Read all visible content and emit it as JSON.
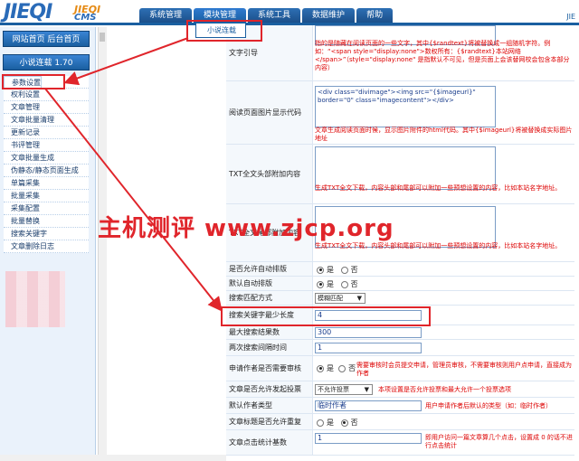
{
  "header": {
    "logo_main": "JIEQI",
    "logo_sub1": "JIEQI",
    "logo_sub2": "CMS",
    "tabs": [
      "系统管理",
      "模块管理",
      "系统工具",
      "数据维护",
      "帮助"
    ],
    "user_link": "JIE"
  },
  "dropdown": {
    "item": "小说连载"
  },
  "sidebar": {
    "home_button": "网站首页 后台首页",
    "module_title": "小说连载 1.70",
    "items": [
      "参数设置",
      "权限管理",
      "权利设置",
      "文章管理",
      "文章批量清理",
      "更新记录",
      "书评管理",
      "文章批量生成",
      "伪静态/静态页面生成",
      "单篇采集",
      "批量采集",
      "采集配置",
      "批量替换",
      "搜索关键字",
      "文章删除日志"
    ]
  },
  "form": {
    "row1": {
      "label": "文字引导",
      "note": "指的是随藏在阅读页面的一些文字，其中{$randtext}将被替换成一组随机字符。例如：“<span style=\"display:none\">数权所有：{$randtext}本站网络</span>”（style=\"display:none\" 是指默认不可见，但是页面上会该替网校会包含本部分内容）"
    },
    "row2": {
      "label": "阅读页面图片显示代码",
      "value": "<div class=\"divimage\"><img src=\"{$imageurl}\" border=\"0\" class=\"imagecontent\"></div>",
      "note": "文章生成阅读页面时候，显示图片附件的html代码。其中{$imageurl}将被替换成实际图片地址"
    },
    "row3": {
      "label": "TXT全文头部附加内容",
      "note": "生成TXT全文下载，内容头部和尾部可以附加一些预想设置的内容，比如本站名字地址。"
    },
    "row4": {
      "label": "TXT全文尾部附加内容",
      "note": "生成TXT全文下载，内容头部和尾部可以附加一些预想设置的内容，比如本站名字地址。"
    },
    "row5": {
      "label": "是否允许自动排版",
      "opt_yes": "是",
      "opt_no": "否"
    },
    "row6": {
      "label": "默认自动排版",
      "opt_yes": "是",
      "opt_no": "否"
    },
    "row7": {
      "label": "搜索匹配方式",
      "value": "模糊匹配"
    },
    "row8": {
      "label": "搜索关键字最少长度",
      "value": "4"
    },
    "row9": {
      "label": "最大搜索结果数",
      "value": "300"
    },
    "row10": {
      "label": "两次搜索间隔时间",
      "value": "1"
    },
    "row11": {
      "label": "申请作者是否需要审核",
      "opt_yes": "是",
      "opt_no": "否",
      "note": "需要审核时会员提交申请，管理员审核，不需要审核则用户点申请，直接成为作者"
    },
    "row12": {
      "label": "文章是否允许发起投票",
      "value": "不允许投票",
      "note": "本项设置是否允许投票和最大允许一个投票选项"
    },
    "row13": {
      "label": "默认作者类型",
      "value": "临时作者",
      "note": "用户申请作者后默认的类型（如：临时作者）"
    },
    "row14": {
      "label": "文章标题是否允许重复",
      "opt_yes": "是",
      "opt_no": "否"
    },
    "row15": {
      "label": "文章点击统计基数",
      "value": "1",
      "note": "即用户访问一篇文章算几个点击，设置成 0 的话不进行点击统计"
    }
  },
  "watermark": "主机测评 www.zjcp.org",
  "colors": {
    "accent": "#1a5fa0",
    "annotation": "#e0252b",
    "note": "#dd0000"
  }
}
